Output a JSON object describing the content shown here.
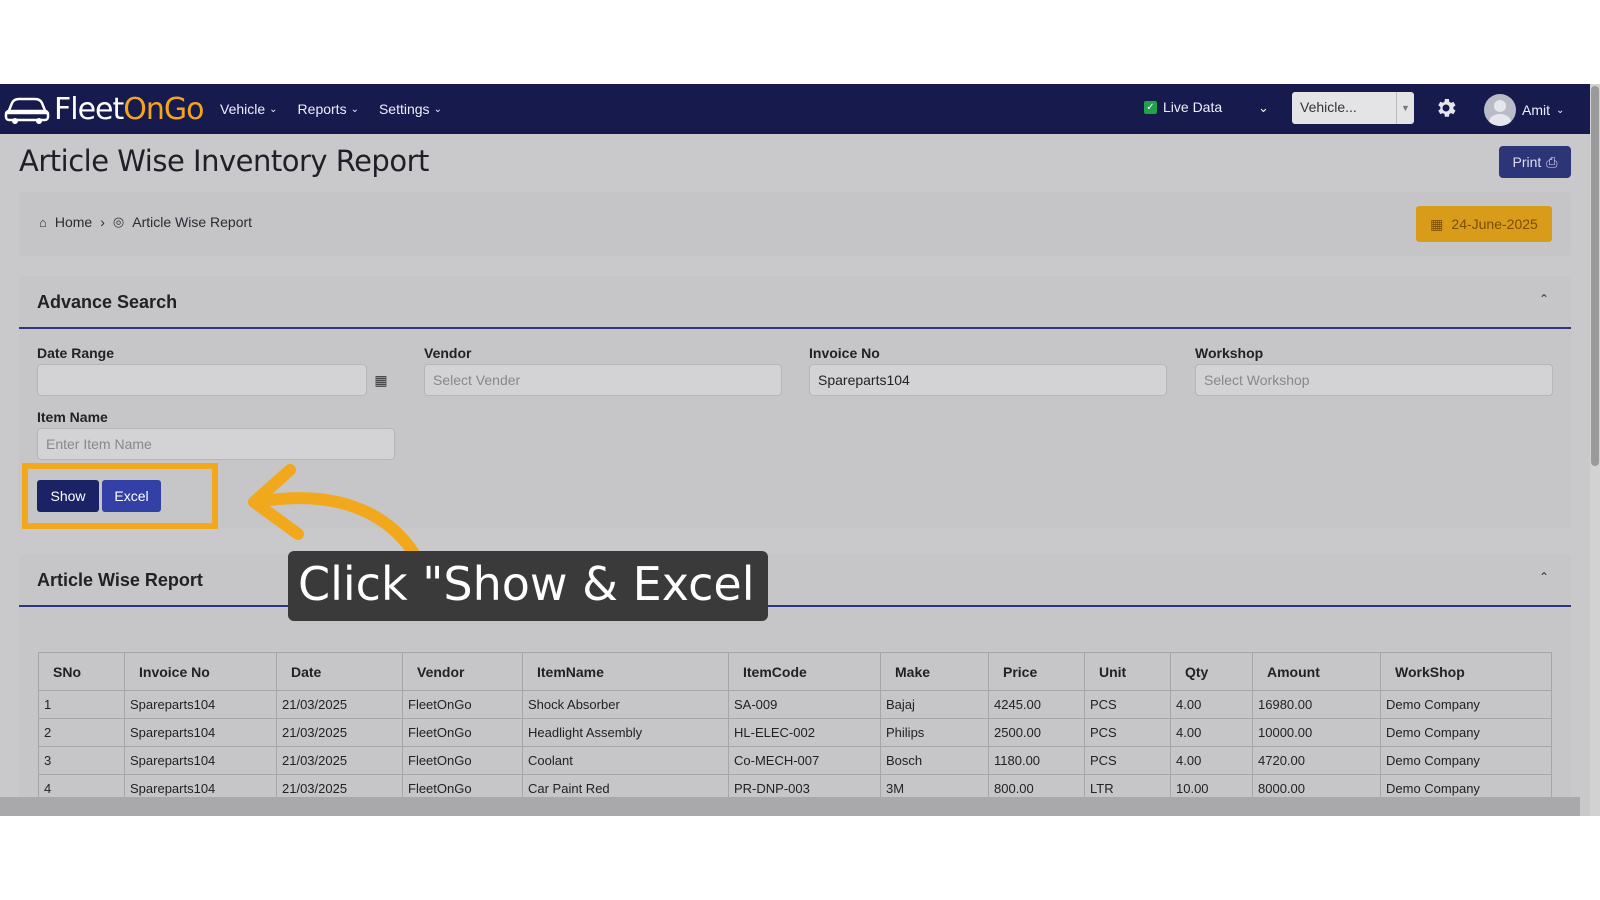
{
  "app": {
    "logo_part1": "Fleet",
    "logo_part2": "OnGo",
    "menu": [
      {
        "label": "Vehicle"
      },
      {
        "label": "Reports"
      },
      {
        "label": "Settings"
      }
    ],
    "live_data_label": "Live Data",
    "vehicle_select_value": "Vehicle...",
    "user_name": "Amit"
  },
  "page": {
    "title": "Article Wise Inventory Report",
    "print_label": "Print",
    "breadcrumb": {
      "home": "Home",
      "current": "Article Wise Report"
    },
    "date": "24-June-2025"
  },
  "search": {
    "title": "Advance Search",
    "date_range_label": "Date Range",
    "vendor_label": "Vendor",
    "vendor_placeholder": "Select Vender",
    "invoice_label": "Invoice No",
    "invoice_value": "Spareparts104",
    "workshop_label": "Workshop",
    "workshop_placeholder": "Select Workshop",
    "item_label": "Item Name",
    "item_placeholder": "Enter Item Name",
    "show_label": "Show",
    "excel_label": "Excel"
  },
  "report": {
    "title": "Article Wise Report",
    "columns": [
      "SNo",
      "Invoice No",
      "Date",
      "Vendor",
      "ItemName",
      "ItemCode",
      "Make",
      "Price",
      "Unit",
      "Qty",
      "Amount",
      "WorkShop"
    ],
    "rows": [
      [
        "1",
        "Spareparts104",
        "21/03/2025",
        "FleetOnGo",
        "Shock Absorber",
        "SA-009",
        "Bajaj",
        "4245.00",
        "PCS",
        "4.00",
        "16980.00",
        "Demo Company"
      ],
      [
        "2",
        "Spareparts104",
        "21/03/2025",
        "FleetOnGo",
        "Headlight Assembly",
        "HL-ELEC-002",
        "Philips",
        "2500.00",
        "PCS",
        "4.00",
        "10000.00",
        "Demo Company"
      ],
      [
        "3",
        "Spareparts104",
        "21/03/2025",
        "FleetOnGo",
        "Coolant",
        "Co-MECH-007",
        "Bosch",
        "1180.00",
        "PCS",
        "4.00",
        "4720.00",
        "Demo Company"
      ],
      [
        "4",
        "Spareparts104",
        "21/03/2025",
        "FleetOnGo",
        "Car Paint Red",
        "PR-DNP-003",
        "3M",
        "800.00",
        "LTR",
        "10.00",
        "8000.00",
        "Demo Company"
      ]
    ]
  },
  "overlay": {
    "tooltip_text": "Click \"Show & Excel"
  },
  "colors": {
    "navbar": "#161a4d",
    "accent": "#f2a81c",
    "primary_button": "#1b2266"
  }
}
